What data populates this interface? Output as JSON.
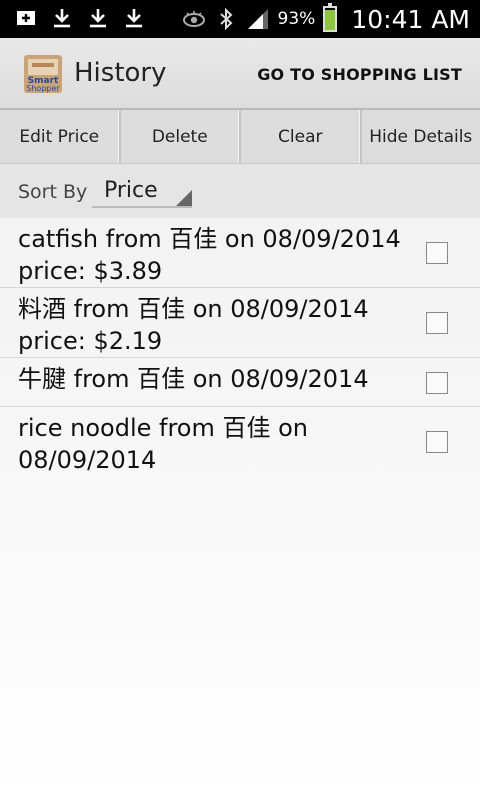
{
  "status_bar": {
    "icons_left": [
      "add-box-icon",
      "download-icon",
      "download-icon",
      "download-icon"
    ],
    "icons_right": [
      "eye-icon",
      "bluetooth-icon",
      "signal-icon"
    ],
    "battery_percent": "93%",
    "battery_level": 0.93,
    "time": "10:41 AM"
  },
  "action_bar": {
    "title": "History",
    "action_label": "GO TO SHOPPING LIST",
    "app_icon": "smart-shopper-logo"
  },
  "buttons": {
    "edit_price": "Edit Price",
    "delete": "Delete",
    "clear": "Clear",
    "hide_details": "Hide Details"
  },
  "sort": {
    "label": "Sort By",
    "value": "Price"
  },
  "items": [
    {
      "line1": "catfish from 百佳 on 08/09/2014",
      "line2": "price: $3.89",
      "checked": false
    },
    {
      "line1": "料酒 from 百佳 on 08/09/2014",
      "line2": "price: $2.19",
      "checked": false
    },
    {
      "line1": "牛腱 from 百佳 on 08/09/2014",
      "line2": "",
      "checked": false
    },
    {
      "line1": "rice noodle from 百佳 on",
      "line2": "08/09/2014",
      "checked": false
    }
  ],
  "colors": {
    "status_bar_bg": "#000000",
    "battery_fill": "#8cc63f",
    "action_bar_bg": "#dcdcdc",
    "list_bg": "#f4f4f4"
  }
}
